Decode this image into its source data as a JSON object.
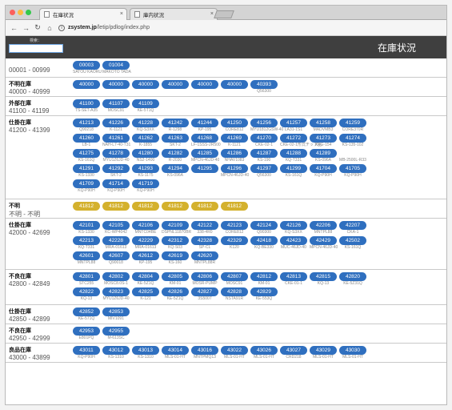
{
  "browser": {
    "tabs": [
      {
        "label": "在庫状況"
      },
      {
        "label": "庫内状況"
      }
    ],
    "url_host": "zsystem.jp",
    "url_path": "/letip/pdlog/index.php"
  },
  "header": {
    "search_label": "検索：",
    "title": "在庫状況"
  },
  "colors": {
    "pill_blue": "#2f6fbf",
    "pill_gold": "#d4b12d",
    "header_bg": "#3f3f3f"
  },
  "rows": [
    {
      "name": "",
      "range": "00001 - 00999",
      "lines": [
        {
          "items": [
            {
              "label": "00003",
              "sub": "SATOU KAORU"
            },
            {
              "label": "01004",
              "sub": "MAKOTO TADA"
            }
          ]
        }
      ]
    },
    {
      "name": "不明在庫",
      "range": "40000 - 40999",
      "lines": [
        {
          "items": [
            {
              "label": "40000",
              "sub": ""
            },
            {
              "label": "40000",
              "sub": ""
            },
            {
              "label": "40000",
              "sub": ""
            },
            {
              "label": "40000",
              "sub": ""
            },
            {
              "label": "40000",
              "sub": ""
            },
            {
              "label": "40000",
              "sub": ""
            },
            {
              "label": "40393",
              "sub": "Q56300"
            }
          ]
        }
      ]
    },
    {
      "name": "外部在庫",
      "range": "41100 - 41199",
      "lines": [
        {
          "items": [
            {
              "label": "41100",
              "sub": "TS-SET-A35"
            },
            {
              "label": "41107",
              "sub": "MOSC91"
            },
            {
              "label": "41109",
              "sub": "KE-5T1Q"
            }
          ]
        }
      ]
    },
    {
      "name": "仕掛在庫",
      "range": "41200 - 41399",
      "lines": [
        {
          "items": [
            {
              "label": "41213",
              "sub": "Q90218"
            },
            {
              "label": "41226",
              "sub": "K-1121"
            },
            {
              "label": "41228",
              "sub": "KQ-S3XX"
            },
            {
              "label": "41242",
              "sub": "R-1298"
            },
            {
              "label": "41244",
              "sub": "KP-195"
            },
            {
              "label": "41250",
              "sub": "CORE812"
            },
            {
              "label": "41256",
              "sub": "MYU1812GSW-40"
            },
            {
              "label": "41257",
              "sub": "LA31-1S1"
            },
            {
              "label": "41258",
              "sub": "MADVMB3"
            },
            {
              "label": "41259",
              "sub": "CORE370R"
            }
          ]
        },
        {
          "items": [
            {
              "label": "41260",
              "sub": "LB-1"
            },
            {
              "label": "41261",
              "sub": "NAH-L7-40-T31"
            },
            {
              "label": "41262",
              "sub": "K-1855"
            },
            {
              "label": "41263",
              "sub": "SKT-2"
            },
            {
              "label": "41268",
              "sub": "LF-1SSS-2R500"
            },
            {
              "label": "41269",
              "sub": "K-1121"
            },
            {
              "label": "41270",
              "sub": "CKE-02-1"
            },
            {
              "label": "41272",
              "sub": "CKE-02-1形式チップ品"
            },
            {
              "label": "41273",
              "sub": "KRG-154"
            },
            {
              "label": "41274",
              "sub": "KS-135-102"
            }
          ]
        },
        {
          "items": [
            {
              "label": "41275",
              "sub": "KS-161Q"
            },
            {
              "label": "41278",
              "sub": "MYU1Z6JD-40"
            },
            {
              "label": "41280",
              "sub": "NS2-1400"
            },
            {
              "label": "41282",
              "sub": "R-2030"
            },
            {
              "label": "41285",
              "sub": "MPCN-46JD-40"
            },
            {
              "label": "41286",
              "sub": "NHAV1083"
            },
            {
              "label": "41287",
              "sub": "KS-190"
            },
            {
              "label": "41288",
              "sub": "KQ-T331"
            },
            {
              "label": "41289",
              "sub": "KS-096A"
            },
            {
              "label": "",
              "sub": "MB-2500L-R33"
            }
          ]
        },
        {
          "items": [
            {
              "label": "41291",
              "sub": "KS-1330"
            },
            {
              "label": "41292",
              "sub": "SKT-2"
            },
            {
              "label": "41293",
              "sub": "KS-1175"
            },
            {
              "label": "41294",
              "sub": "KS-096A"
            },
            {
              "label": "41295",
              "sub": ""
            },
            {
              "label": "41296",
              "sub": "MPCN-46JD-40"
            },
            {
              "label": "41297",
              "sub": "Q56300"
            },
            {
              "label": "41299",
              "sub": "KS-161Q"
            },
            {
              "label": "41704",
              "sub": "KQ-P90H"
            },
            {
              "label": "41705",
              "sub": "KQ-P90H"
            }
          ]
        },
        {
          "items": [
            {
              "label": "41709",
              "sub": "KQ-P90H"
            },
            {
              "label": "41714",
              "sub": "KQ-P90H"
            },
            {
              "label": "41719",
              "sub": "KQ-P90H"
            }
          ]
        }
      ]
    },
    {
      "name": "不明",
      "range": "不明 - 不明",
      "gold": true,
      "lines": [
        {
          "items": [
            {
              "label": "41812",
              "sub": ""
            },
            {
              "label": "41812",
              "sub": ""
            },
            {
              "label": "41812",
              "sub": ""
            },
            {
              "label": "41812",
              "sub": ""
            },
            {
              "label": "41812",
              "sub": ""
            },
            {
              "label": "41812",
              "sub": ""
            }
          ]
        }
      ]
    },
    {
      "name": "仕掛在庫",
      "range": "42000 - 42699",
      "lines": [
        {
          "items": [
            {
              "label": "42101",
              "sub": "KS-1330"
            },
            {
              "label": "42105",
              "sub": "KC-WP4042"
            },
            {
              "label": "42106",
              "sub": "MNTC04BE"
            },
            {
              "label": "42109",
              "sub": "DSPNL11870BR"
            },
            {
              "label": "42122",
              "sub": "338-4R0"
            },
            {
              "label": "42123",
              "sub": "CORE812"
            },
            {
              "label": "42124",
              "sub": "Q90300"
            },
            {
              "label": "42126",
              "sub": "KQ-S3XX"
            },
            {
              "label": "42206",
              "sub": "MNTPL88"
            },
            {
              "label": "42207",
              "sub": "CKA-1"
            }
          ]
        },
        {
          "items": [
            {
              "label": "42213",
              "sub": "KQ-T331"
            },
            {
              "label": "42228",
              "sub": "MRA-01613"
            },
            {
              "label": "42229",
              "sub": "MRA-01613"
            },
            {
              "label": "42312",
              "sub": "KQ-S03"
            },
            {
              "label": "42328",
              "sub": "SP-CL"
            },
            {
              "label": "42329",
              "sub": "K120"
            },
            {
              "label": "42418",
              "sub": "KQ-BE330"
            },
            {
              "label": "42423",
              "sub": "MUC-46JD-40"
            },
            {
              "label": "42429",
              "sub": "MPCN-46JD-40"
            },
            {
              "label": "42502",
              "sub": "KS-161Q"
            }
          ]
        },
        {
          "items": [
            {
              "label": "42601",
              "sub": "MNTPL88"
            },
            {
              "label": "42607",
              "sub": "Q90018"
            },
            {
              "label": "42612",
              "sub": "KP-195"
            },
            {
              "label": "42619",
              "sub": "KS-160"
            },
            {
              "label": "42620",
              "sub": "MNTPL88R"
            }
          ]
        }
      ]
    },
    {
      "name": "不良在庫",
      "range": "42800 - 42849",
      "lines": [
        {
          "items": [
            {
              "label": "42801",
              "sub": "STC255"
            },
            {
              "label": "42802",
              "sub": "MOSC8.0S-1"
            },
            {
              "label": "42804",
              "sub": "KE-5Z1Q"
            },
            {
              "label": "42805",
              "sub": "KM-01"
            },
            {
              "label": "42806",
              "sub": "MOSR-PUMP"
            },
            {
              "label": "42807",
              "sub": "MOSC91"
            },
            {
              "label": "42812",
              "sub": "KM-01"
            },
            {
              "label": "42813",
              "sub": "CKE-01-1"
            },
            {
              "label": "42815",
              "sub": "KQ-13"
            },
            {
              "label": "42820",
              "sub": "KE-5Z31Q"
            }
          ]
        },
        {
          "items": [
            {
              "label": "42822",
              "sub": "KQ-13"
            },
            {
              "label": "42823",
              "sub": "MYU1Z6JD-40"
            },
            {
              "label": "42825",
              "sub": "K-121"
            },
            {
              "label": "42826",
              "sub": "KE-5Z1Q"
            },
            {
              "label": "42827",
              "sub": "3S5007"
            },
            {
              "label": "42828",
              "sub": "NSTA91R"
            },
            {
              "label": "42829",
              "sub": "KE-553Q"
            }
          ]
        }
      ]
    },
    {
      "name": "仕掛在庫",
      "range": "42850 - 42899",
      "lines": [
        {
          "items": [
            {
              "label": "42852",
              "sub": "KE-571Q"
            },
            {
              "label": "42853",
              "sub": "MIV1091"
            }
          ]
        }
      ]
    },
    {
      "name": "不良在庫",
      "range": "42950 - 42999",
      "lines": [
        {
          "items": [
            {
              "label": "42953",
              "sub": "E801PQ"
            },
            {
              "label": "42955",
              "sub": "M-613SC"
            }
          ]
        }
      ]
    },
    {
      "name": "良品在庫",
      "range": "43000 - 43899",
      "lines": [
        {
          "items": [
            {
              "label": "43011",
              "sub": "KQ-P90H"
            },
            {
              "label": "43012",
              "sub": "KS-1310"
            },
            {
              "label": "43013",
              "sub": "KS-1310"
            },
            {
              "label": "43014",
              "sub": "MLS-01-HT"
            },
            {
              "label": "43016",
              "sub": "MNTPMQ13"
            },
            {
              "label": "43022",
              "sub": "MLS-01-HT"
            },
            {
              "label": "43026",
              "sub": "MLS-01-HT"
            },
            {
              "label": "43027",
              "sub": "CRD218"
            },
            {
              "label": "43029",
              "sub": "MLS-01-HT"
            },
            {
              "label": "43030",
              "sub": "MLS-01-HT"
            }
          ]
        }
      ]
    }
  ]
}
